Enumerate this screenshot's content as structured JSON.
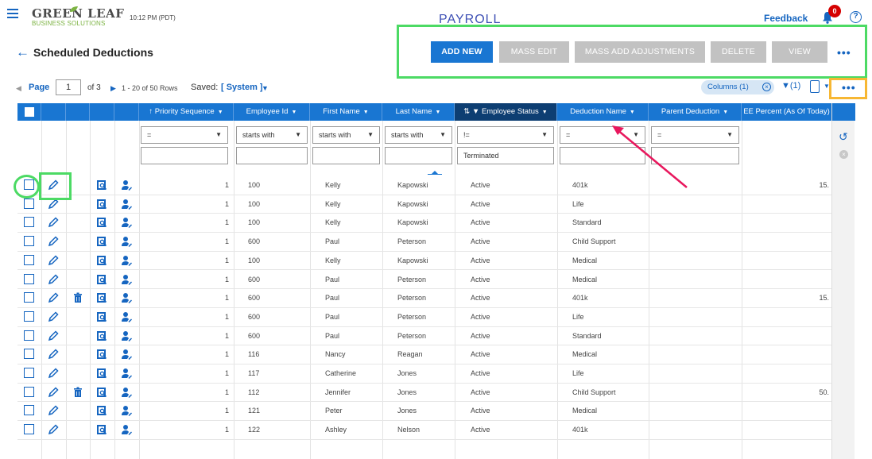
{
  "header": {
    "logo_main": "GREEN LEAF",
    "logo_sub": "BUSINESS SOLUTIONS",
    "time": "10:12 PM (PDT)",
    "app_title": "PAYROLL",
    "feedback_label": "Feedback",
    "notifications_count": "0",
    "help_label": "?"
  },
  "page": {
    "title": "Scheduled Deductions"
  },
  "actions": {
    "add_new": "ADD NEW",
    "mass_edit": "MASS EDIT",
    "mass_add_adjustments": "MASS ADD ADJUSTMENTS",
    "delete": "DELETE",
    "view": "VIEW",
    "more": "•••"
  },
  "pager": {
    "page_label": "Page",
    "page_value": "1",
    "of_text": "of 3",
    "rows_text": "1 - 20 of 50 Rows",
    "saved_label": "Saved:",
    "saved_view": "[ System ]",
    "columns_label": "Columns (1)",
    "filter_count": "(1)",
    "more": "•••"
  },
  "columns": [
    {
      "label": "Priority Sequence",
      "sort": "↑"
    },
    {
      "label": "Employee Id"
    },
    {
      "label": "First Name"
    },
    {
      "label": "Last Name"
    },
    {
      "label": "Employee Status",
      "sort": "⇅"
    },
    {
      "label": "Deduction Name"
    },
    {
      "label": "Parent Deduction"
    },
    {
      "label": "EE Percent (As Of Today)"
    }
  ],
  "filters": {
    "priority_op": "=",
    "employee_id_op": "starts with",
    "first_name_op": "starts with",
    "last_name_op": "starts with",
    "status_op": "!=",
    "status_value": "Terminated",
    "deduction_op": "=",
    "parent_op": "="
  },
  "rows": [
    {
      "priority": "1",
      "emp_id": "100",
      "first": "Kelly",
      "last": "Kapowski",
      "status": "Active",
      "deduction": "401k",
      "ee": "15.",
      "trash": false
    },
    {
      "priority": "1",
      "emp_id": "100",
      "first": "Kelly",
      "last": "Kapowski",
      "status": "Active",
      "deduction": "Life",
      "ee": "",
      "trash": false
    },
    {
      "priority": "1",
      "emp_id": "100",
      "first": "Kelly",
      "last": "Kapowski",
      "status": "Active",
      "deduction": "Standard",
      "ee": "",
      "trash": false
    },
    {
      "priority": "1",
      "emp_id": "600",
      "first": "Paul",
      "last": "Peterson",
      "status": "Active",
      "deduction": "Child Support",
      "ee": "",
      "trash": false
    },
    {
      "priority": "1",
      "emp_id": "100",
      "first": "Kelly",
      "last": "Kapowski",
      "status": "Active",
      "deduction": "Medical",
      "ee": "",
      "trash": false
    },
    {
      "priority": "1",
      "emp_id": "600",
      "first": "Paul",
      "last": "Peterson",
      "status": "Active",
      "deduction": "Medical",
      "ee": "",
      "trash": false
    },
    {
      "priority": "1",
      "emp_id": "600",
      "first": "Paul",
      "last": "Peterson",
      "status": "Active",
      "deduction": "401k",
      "ee": "15.",
      "trash": true
    },
    {
      "priority": "1",
      "emp_id": "600",
      "first": "Paul",
      "last": "Peterson",
      "status": "Active",
      "deduction": "Life",
      "ee": "",
      "trash": false
    },
    {
      "priority": "1",
      "emp_id": "600",
      "first": "Paul",
      "last": "Peterson",
      "status": "Active",
      "deduction": "Standard",
      "ee": "",
      "trash": false
    },
    {
      "priority": "1",
      "emp_id": "116",
      "first": "Nancy",
      "last": "Reagan",
      "status": "Active",
      "deduction": "Medical",
      "ee": "",
      "trash": false
    },
    {
      "priority": "1",
      "emp_id": "117",
      "first": "Catherine",
      "last": "Jones",
      "status": "Active",
      "deduction": "Life",
      "ee": "",
      "trash": false
    },
    {
      "priority": "1",
      "emp_id": "112",
      "first": "Jennifer",
      "last": "Jones",
      "status": "Active",
      "deduction": "Child Support",
      "ee": "50.",
      "trash": true
    },
    {
      "priority": "1",
      "emp_id": "121",
      "first": "Peter",
      "last": "Jones",
      "status": "Active",
      "deduction": "Medical",
      "ee": "",
      "trash": false
    },
    {
      "priority": "1",
      "emp_id": "122",
      "first": "Ashley",
      "last": "Nelson",
      "status": "Active",
      "deduction": "401k",
      "ee": "",
      "trash": false
    }
  ],
  "colors": {
    "accent": "#1976d2",
    "header_selected": "#0d3e72",
    "annotation_green": "#4cda64",
    "annotation_orange": "#f7b733",
    "annotation_arrow": "#e8175d",
    "disabled_button": "#c2c2c2"
  },
  "icons": [
    "menu-icon",
    "back-arrow-icon",
    "bell-icon",
    "help-icon",
    "pencil-icon",
    "trash-icon",
    "view-record-icon",
    "employee-icon",
    "filter-icon",
    "export-icon",
    "undo-icon",
    "clear-filter-icon"
  ]
}
